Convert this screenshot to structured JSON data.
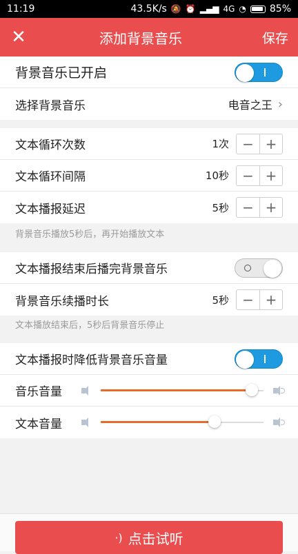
{
  "status_bar": {
    "time": "11:19",
    "speed": "43.5K/s",
    "network": "4G",
    "battery": "85%"
  },
  "header": {
    "title": "添加背景音乐",
    "save_label": "保存"
  },
  "bgm_toggle": {
    "label": "背景音乐已开启",
    "on": true
  },
  "select_music": {
    "label": "选择背景音乐",
    "value": "电音之王"
  },
  "loop_count": {
    "label": "文本循环次数",
    "value": "1次",
    "minus": "−",
    "plus": "+"
  },
  "loop_interval": {
    "label": "文本循环间隔",
    "value": "10秒",
    "minus": "−",
    "plus": "+"
  },
  "play_delay": {
    "label": "文本播报延迟",
    "value": "5秒",
    "minus": "−",
    "plus": "+"
  },
  "delay_note": "背景音乐播放5秒后，再开始播放文本",
  "finish_toggle": {
    "label": "文本播报结束后播完背景音乐",
    "on": false
  },
  "continue_duration": {
    "label": "背景音乐续播时长",
    "value": "5秒",
    "minus": "−",
    "plus": "+"
  },
  "continue_note": "文本播放结束后，5秒后背景音乐停止",
  "duck_toggle": {
    "label": "文本播报时降低背景音乐音量",
    "on": true
  },
  "music_volume": {
    "label": "音乐音量",
    "level": 0.93
  },
  "text_volume": {
    "label": "文本音量",
    "level": 0.7
  },
  "listen_button": {
    "label": "点击试听"
  },
  "colors": {
    "accent": "#ea4d4d",
    "toggle_on": "#1e9be0",
    "slider_fill": "#e66a28"
  }
}
